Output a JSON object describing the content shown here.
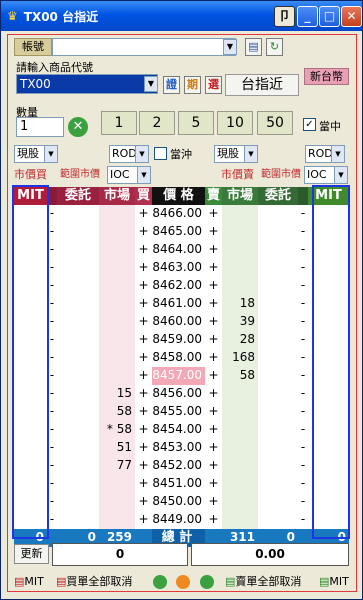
{
  "title": "TX00 台指近",
  "account": {
    "label": "帳號",
    "value": ""
  },
  "product": {
    "label": "請輸入商品代號",
    "code": "TX00",
    "btn1": "證",
    "btn2": "期",
    "btn3": "選",
    "name": "台指近",
    "currency": "新台幣"
  },
  "qty": {
    "label": "數量",
    "value": "1",
    "buttons": [
      "1",
      "2",
      "5",
      "10",
      "50"
    ],
    "check_label": "當中"
  },
  "left": {
    "cond": "現股",
    "type": "ROD",
    "daytrade": "當沖",
    "tag1": "市價買",
    "tag2": "範圍市價",
    "tif": "IOC"
  },
  "right": {
    "cond": "現股",
    "type": "ROD",
    "tag1": "市價賣",
    "tag2": "範圍市價",
    "tif": "IOC"
  },
  "headers": {
    "mit_left": "MIT",
    "buy_entrust": "委託",
    "buy_market": "市場",
    "buy": "買",
    "price": "價 格",
    "sell": "賣",
    "sell_market": "市場",
    "sell_entrust": "委託",
    "mit_right": "MIT"
  },
  "rows": [
    {
      "bm": "",
      "b": "+",
      "p": "8466.00",
      "s": "+",
      "sm": ""
    },
    {
      "bm": "",
      "b": "+",
      "p": "8465.00",
      "s": "+",
      "sm": ""
    },
    {
      "bm": "",
      "b": "+",
      "p": "8464.00",
      "s": "+",
      "sm": ""
    },
    {
      "bm": "",
      "b": "+",
      "p": "8463.00",
      "s": "+",
      "sm": ""
    },
    {
      "bm": "",
      "b": "+",
      "p": "8462.00",
      "s": "+",
      "sm": ""
    },
    {
      "bm": "",
      "b": "+",
      "p": "8461.00",
      "s": "+",
      "sm": "18"
    },
    {
      "bm": "",
      "b": "+",
      "p": "8460.00",
      "s": "+",
      "sm": "39"
    },
    {
      "bm": "",
      "b": "+",
      "p": "8459.00",
      "s": "+",
      "sm": "28"
    },
    {
      "bm": "",
      "b": "+",
      "p": "8458.00",
      "s": "+",
      "sm": "168"
    },
    {
      "bm": "",
      "b": "+",
      "p": "8457.00",
      "s": "+",
      "sm": "58"
    },
    {
      "bm": "15",
      "b": "+",
      "p": "8456.00",
      "s": "+",
      "sm": ""
    },
    {
      "bm": "58",
      "b": "+",
      "p": "8455.00",
      "s": "+",
      "sm": ""
    },
    {
      "bm": "* 58",
      "b": "+",
      "p": "8454.00",
      "s": "+",
      "sm": ""
    },
    {
      "bm": "51",
      "b": "+",
      "p": "8453.00",
      "s": "+",
      "sm": ""
    },
    {
      "bm": "77",
      "b": "+",
      "p": "8452.00",
      "s": "+",
      "sm": ""
    },
    {
      "bm": "",
      "b": "+",
      "p": "8451.00",
      "s": "+",
      "sm": ""
    },
    {
      "bm": "",
      "b": "+",
      "p": "8450.00",
      "s": "+",
      "sm": ""
    },
    {
      "bm": "",
      "b": "+",
      "p": "8449.00",
      "s": "+",
      "sm": ""
    }
  ],
  "dash": "-",
  "totals": {
    "mit_left": "0",
    "buy_entrust": "0",
    "buy_market": "259",
    "label": "總 計",
    "sell_market": "311",
    "sell_entrust": "0",
    "mit_right": "0"
  },
  "status": {
    "refresh": "更新",
    "v1": "0",
    "v2": "0.00"
  },
  "bottom": {
    "mit_left": "MIT",
    "buy_cancel": "買單全部取消",
    "sell_cancel": "賣單全部取消",
    "mit_right": "MIT"
  }
}
